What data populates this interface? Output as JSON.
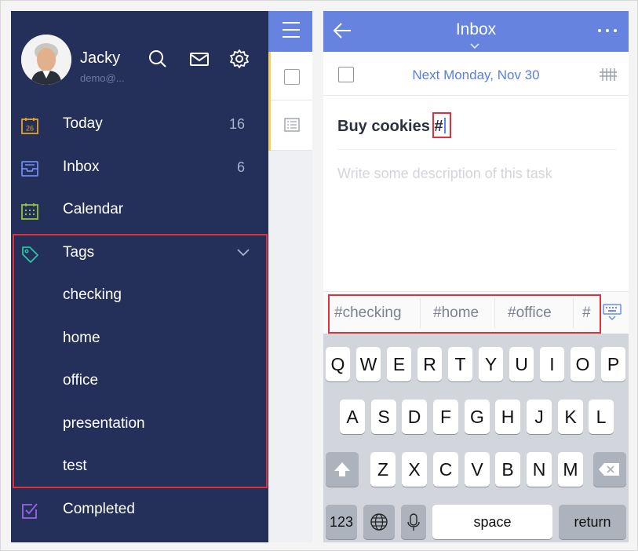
{
  "drawer": {
    "user_name": "Jacky",
    "user_email": "demo@...",
    "today": {
      "label": "Today",
      "count": "16",
      "icon_day": "26"
    },
    "inbox": {
      "label": "Inbox",
      "count": "6"
    },
    "calendar": {
      "label": "Calendar"
    },
    "tags": {
      "label": "Tags",
      "items": [
        "checking",
        "home",
        "office",
        "presentation",
        "test"
      ]
    },
    "completed": {
      "label": "Completed"
    }
  },
  "task": {
    "header_title": "Inbox",
    "due_date": "Next Monday, Nov 30",
    "title_text": "Buy cookies",
    "title_tag": "#",
    "description_placeholder": "Write some description of this task"
  },
  "tag_suggestions": [
    "#checking",
    "#home",
    "#office",
    "#"
  ],
  "keyboard": {
    "row1": [
      "Q",
      "W",
      "E",
      "R",
      "T",
      "Y",
      "U",
      "I",
      "O",
      "P"
    ],
    "row2": [
      "A",
      "S",
      "D",
      "F",
      "G",
      "H",
      "J",
      "K",
      "L"
    ],
    "row3": [
      "Z",
      "X",
      "C",
      "V",
      "B",
      "N",
      "M"
    ],
    "numbers_label": "123",
    "space_label": "space",
    "return_label": "return"
  },
  "colors": {
    "drawer_bg": "#24305a",
    "accent_blue": "#6783e0",
    "highlight_red": "#e0303a",
    "today_icon": "#e7a521",
    "inbox_icon": "#6d8bf0",
    "calendar_icon": "#8fc63c",
    "tags_icon": "#2bc4a4",
    "completed_icon": "#9a63e8"
  },
  "icons": [
    "search-icon",
    "mail-icon",
    "gear-icon",
    "today-icon",
    "inbox-icon",
    "calendar-icon",
    "tag-icon",
    "chevron-down-icon",
    "completed-icon",
    "back-arrow-icon",
    "more-icon",
    "priority-icon",
    "keyboard-hide-icon",
    "shift-icon",
    "delete-icon",
    "globe-icon",
    "microphone-icon",
    "menu-icon"
  ]
}
